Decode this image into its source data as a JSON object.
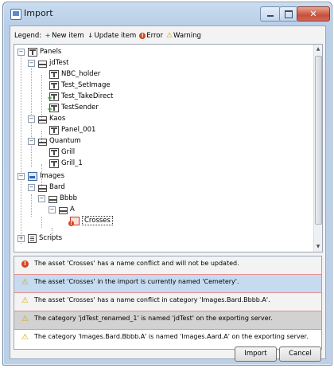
{
  "window": {
    "title": "Import",
    "controls": {
      "minimize": "–",
      "maximize": "□",
      "close": "✕"
    }
  },
  "legend": {
    "label": "Legend:",
    "items": [
      {
        "icon": "new-item-icon",
        "glyph": "+",
        "label": "New item"
      },
      {
        "icon": "update-item-icon",
        "glyph": "↓",
        "label": "Update item"
      },
      {
        "icon": "error-icon",
        "glyph": "!",
        "label": "Error"
      },
      {
        "icon": "warning-icon",
        "glyph": "⚠",
        "label": "Warning"
      }
    ]
  },
  "tree": {
    "panels": {
      "label": "Panels"
    },
    "jdtest": {
      "label": "jdTest"
    },
    "nbc_holder": {
      "label": "NBC_holder"
    },
    "test_setimage": {
      "label": "Test_SetImage"
    },
    "test_takedirect": {
      "label": "Test_TakeDirect"
    },
    "testsender": {
      "label": "TestSender"
    },
    "kaos": {
      "label": "Kaos"
    },
    "panel_001": {
      "label": "Panel_001"
    },
    "quantum": {
      "label": "Quantum"
    },
    "grill": {
      "label": "Grill"
    },
    "grill_1": {
      "label": "Grill_1"
    },
    "images": {
      "label": "Images"
    },
    "bard": {
      "label": "Bard"
    },
    "bbbb": {
      "label": "Bbbb"
    },
    "a": {
      "label": "A"
    },
    "crosses": {
      "label": "Crosses"
    },
    "scripts": {
      "label": "Scripts"
    }
  },
  "messages": [
    {
      "type": "error",
      "text": "The asset 'Crosses' has a name conflict and will not be updated.",
      "bg": "#f3f3f3"
    },
    {
      "type": "warning",
      "text": "The asset 'Crosses' in the import is currently named 'Cemetery'.",
      "bg": "#c6daf0"
    },
    {
      "type": "warning",
      "text": "The asset 'Crosses' has a name conflict in category 'Images.Bard.Bbbb.A'.",
      "bg": "#f3f3f3"
    },
    {
      "type": "warning",
      "text": "The category 'jdTest_renamed_1' is named 'jdTest' on the exporting server.",
      "bg": "#d2d2d2"
    },
    {
      "type": "warning",
      "text": "The category 'Images.Bard.Bbbb.A' is named 'Images.Aard.A' on the exporting server.",
      "bg": "#ffffff"
    }
  ],
  "buttons": {
    "import": "Import",
    "cancel": "Cancel"
  },
  "colors": {
    "new": "#1a8a2a",
    "error": "#d4461e",
    "warning": "#d9a300",
    "selection": "#c6daf0"
  }
}
